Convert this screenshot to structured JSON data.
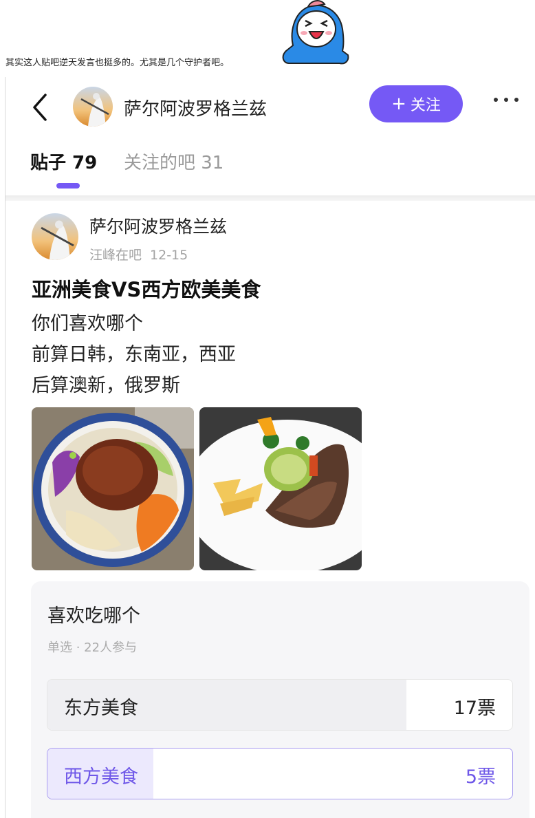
{
  "intro_text": "其实这人贴吧逆天发言也挺多的。尤其是几个守护者吧。",
  "header": {
    "username": "萨尔阿波罗格兰兹",
    "follow_label": "关注",
    "follow_icon": "plus-icon",
    "more_icon": "more-dots-icon",
    "back_icon": "chevron-left-icon"
  },
  "tabs": [
    {
      "label": "贴子 79",
      "active": true
    },
    {
      "label": "关注的吧 31",
      "active": false
    }
  ],
  "post": {
    "author": "萨尔阿波罗格兰兹",
    "forum": "汪峰在吧",
    "date": "12-15",
    "title": "亚洲美食VS西方欧美美食",
    "lines": [
      "你们喜欢哪个",
      "前算日韩，东南亚，西亚",
      "后算澳新，俄罗斯"
    ]
  },
  "poll": {
    "title": "喜欢吃哪个",
    "subtitle": "单选 · 22人参与",
    "options": [
      {
        "label": "东方美食",
        "votes": "17票",
        "count": 17
      },
      {
        "label": "西方美食",
        "votes": "5票",
        "count": 5
      }
    ],
    "total": 22
  },
  "colors": {
    "accent": "#7559f5",
    "selected_text": "#6e57e8"
  }
}
